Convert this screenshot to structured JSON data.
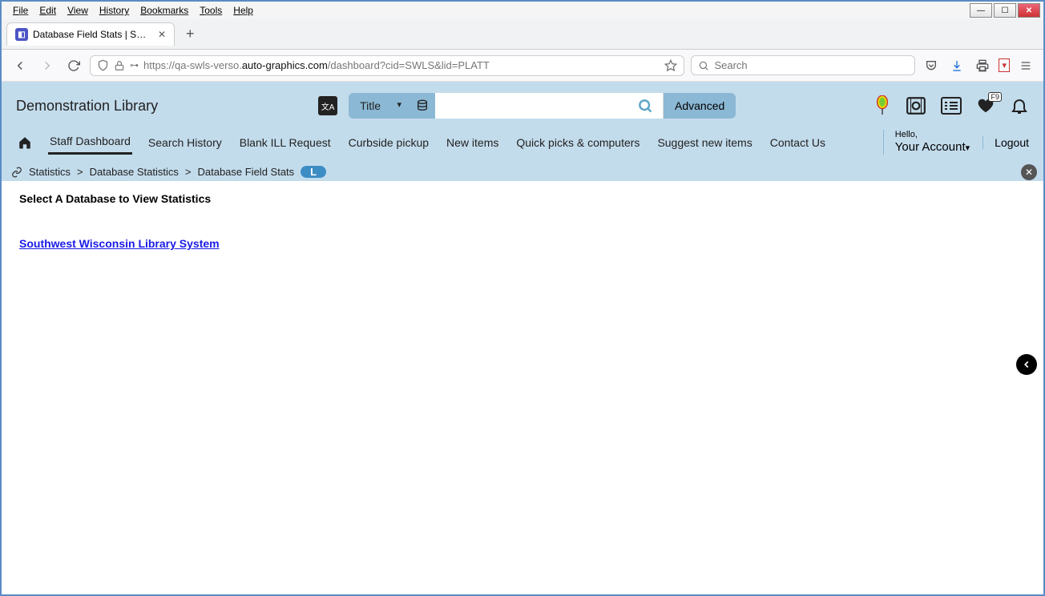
{
  "window": {
    "menu": [
      "File",
      "Edit",
      "View",
      "History",
      "Bookmarks",
      "Tools",
      "Help"
    ],
    "tab_title": "Database Field Stats | SWLS | pla",
    "url_host_prefix": "https://qa-swls-verso.",
    "url_domain": "auto-graphics.com",
    "url_path": "/dashboard?cid=SWLS&lid=PLATT",
    "search_placeholder": "Search"
  },
  "app": {
    "library_name": "Demonstration Library",
    "search_type": "Title",
    "advanced_label": "Advanced",
    "fav_badge": "F9",
    "nav": [
      "Staff Dashboard",
      "Search History",
      "Blank ILL Request",
      "Curbside pickup",
      "New items",
      "Quick picks & computers",
      "Suggest new items",
      "Contact Us"
    ],
    "hello": "Hello,",
    "account": "Your Account",
    "logout": "Logout"
  },
  "breadcrumb": {
    "items": [
      "Statistics",
      "Database Statistics",
      "Database Field Stats"
    ],
    "pill": "L"
  },
  "content": {
    "heading": "Select A Database to View Statistics",
    "db_link": "Southwest Wisconsin Library System"
  }
}
